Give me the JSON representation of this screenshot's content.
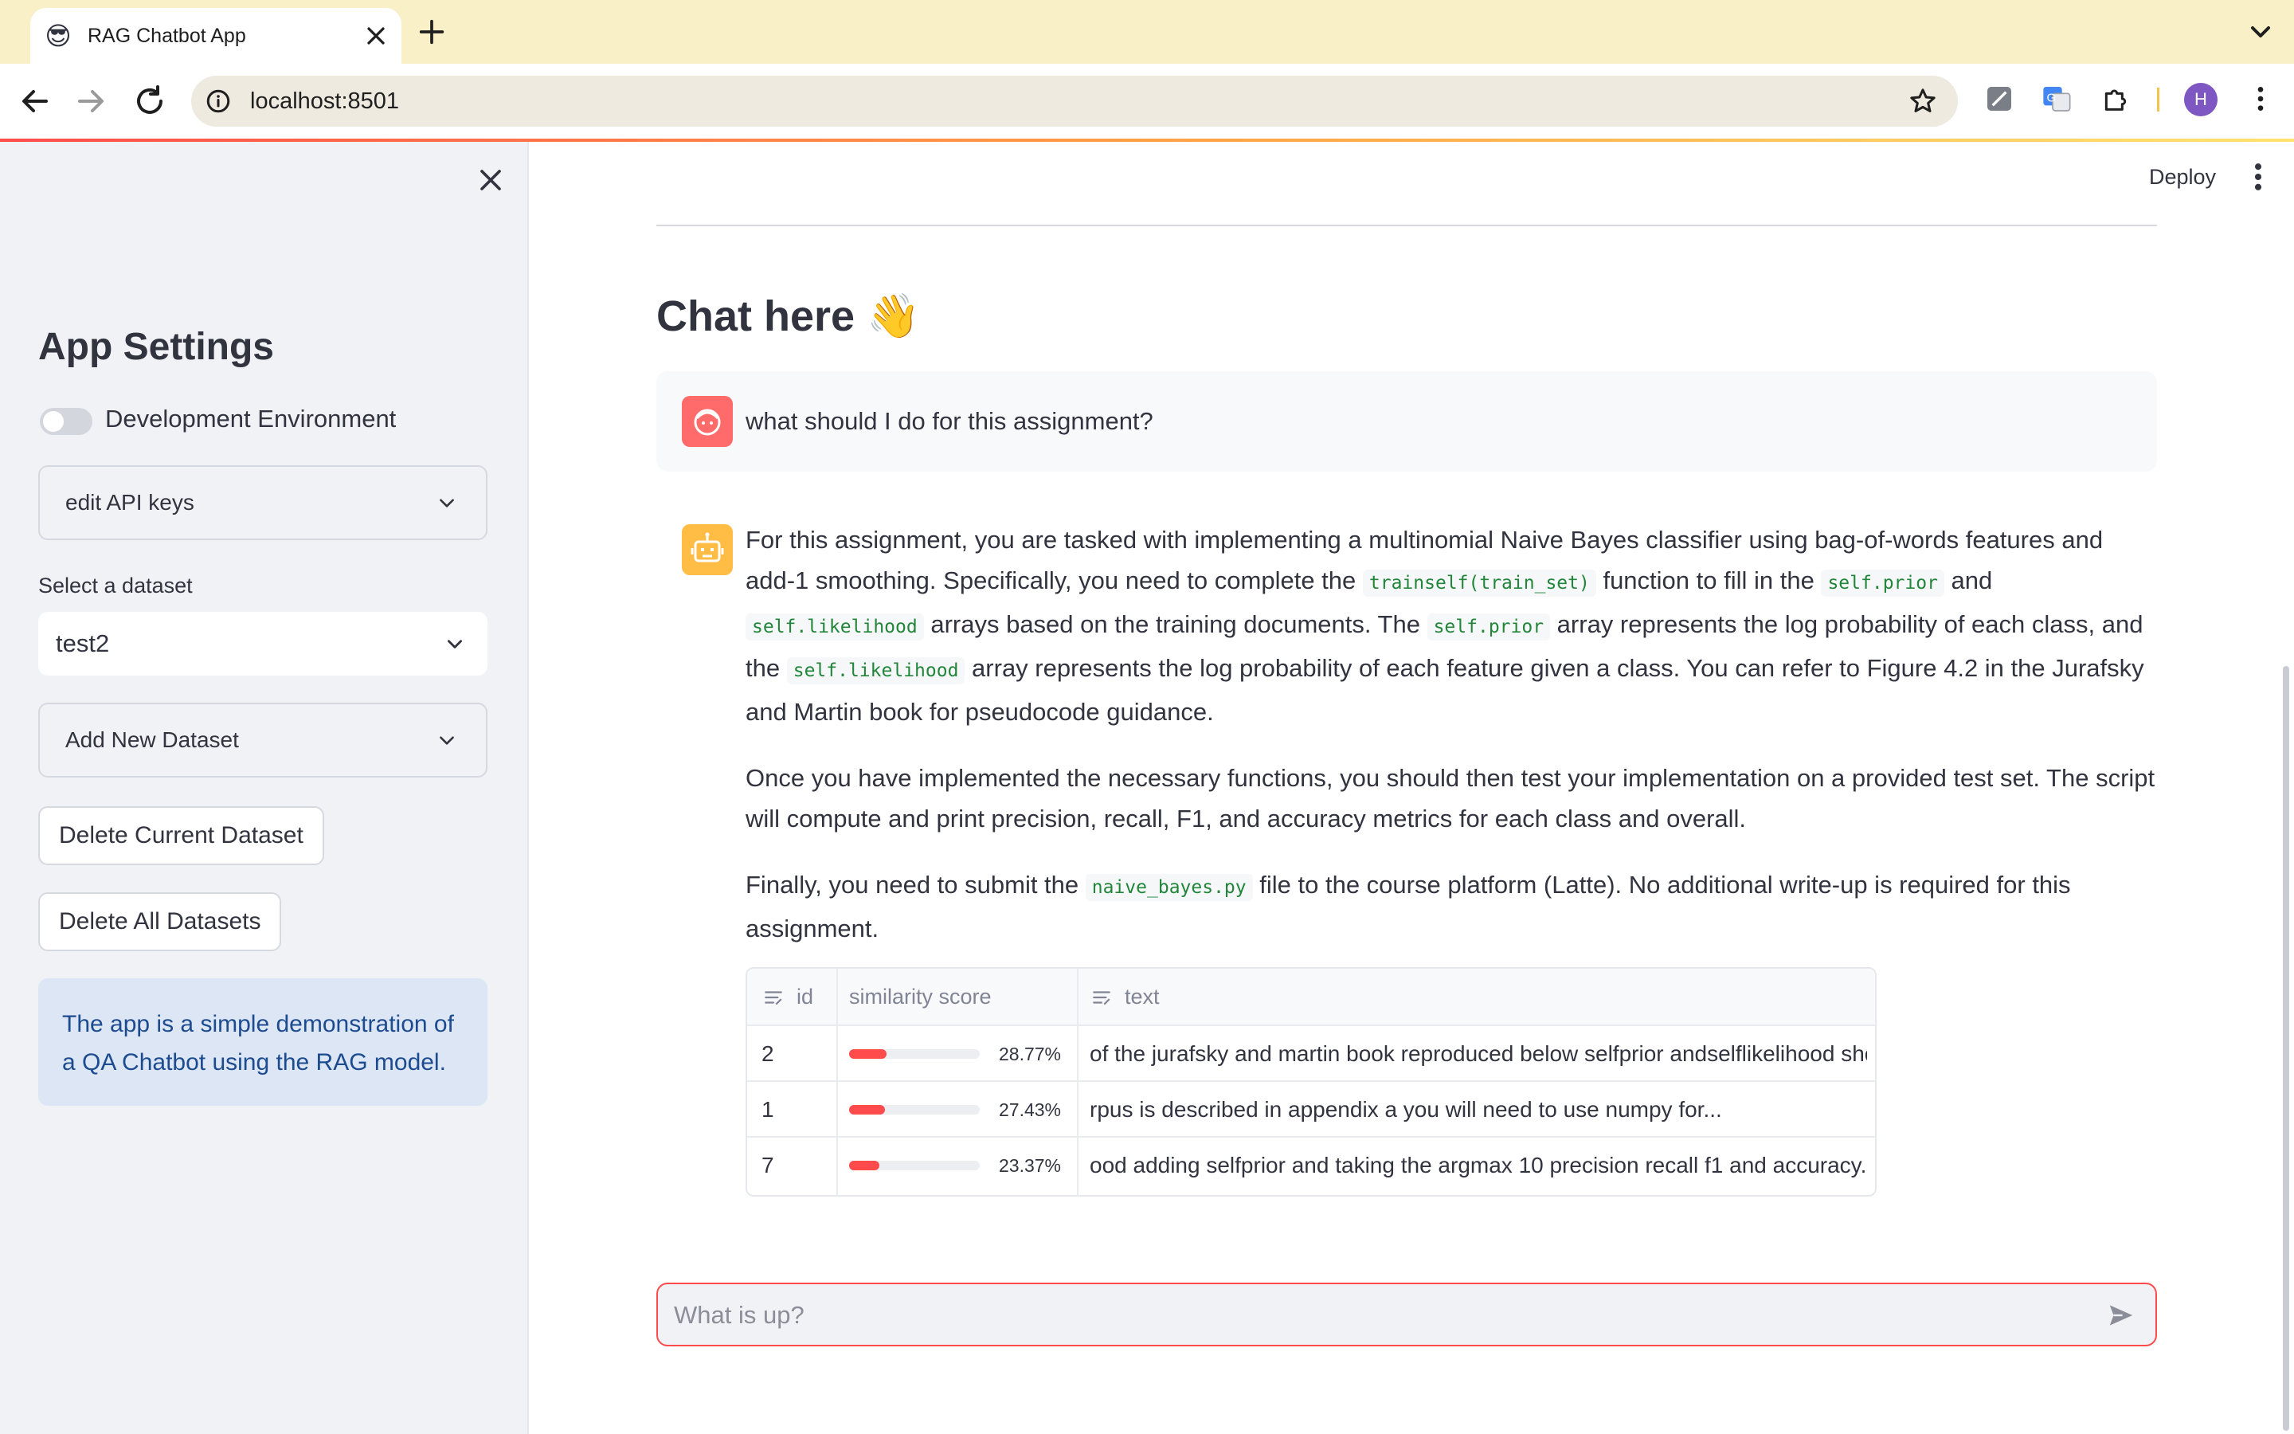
{
  "browser": {
    "tab_title": "RAG Chatbot App",
    "favicon": "😎",
    "url": "localhost:8501",
    "profile_initial": "H"
  },
  "sidebar": {
    "title": "App Settings",
    "toggle_label": "Development Environment",
    "toggle_on": false,
    "api_keys_expander": "edit API keys",
    "dataset_label": "Select a dataset",
    "dataset_selected": "test2",
    "add_dataset_expander": "Add New Dataset",
    "delete_current_label": "Delete Current Dataset",
    "delete_all_label": "Delete All Datasets",
    "info_text": "The app is a simple demonstration of a QA Chatbot using the RAG model."
  },
  "header": {
    "deploy_label": "Deploy"
  },
  "chat": {
    "title": "Chat here 👋",
    "user_message": "what should I do for this assignment?",
    "assistant_paragraphs": {
      "p1": {
        "t1": "For this assignment, you are tasked with implementing a multinomial Naive Bayes classifier using bag-of-words features and add-1 smoothing. Specifically, you need to complete the ",
        "c1": "trainself(train_set)",
        "t2": " function to fill in the ",
        "c2": "self.prior",
        "t3": " and ",
        "c3": "self.likelihood",
        "t4": " arrays based on the training documents. The ",
        "c4": "self.prior",
        "t5": " array represents the log probability of each class, and the ",
        "c5": "self.likelihood",
        "t6": " array represents the log probability of each feature given a class. You can refer to Figure 4.2 in the Jurafsky and Martin book for pseudocode guidance."
      },
      "p2": "Once you have implemented the necessary functions, you should then test your implementation on a provided test set. The script will compute and print precision, recall, F1, and accuracy metrics for each class and overall.",
      "p3": {
        "t1": "Finally, you need to submit the ",
        "c1": "naive_bayes.py",
        "t2": " file to the course platform (Latte). No additional write-up is required for this assignment."
      }
    },
    "table": {
      "columns": [
        "id",
        "similarity score",
        "text"
      ],
      "rows": [
        {
          "id": "2",
          "score": 0.2877,
          "score_label": "28.77%",
          "text": "of the jurafsky and martin book reproduced below selfprior andselflikelihood should"
        },
        {
          "id": "1",
          "score": 0.2743,
          "score_label": "27.43%",
          "text": "rpus is described in appendix a you will need to use numpy for..."
        },
        {
          "id": "7",
          "score": 0.2337,
          "score_label": "23.37%",
          "text": "ood adding selfprior and taking the argmax 10 precision recall f1 and accuracy..."
        }
      ]
    },
    "input_placeholder": "What is up?"
  },
  "colors": {
    "accent": "#ff4b4b",
    "sidebar_bg": "#f0f2f6",
    "info_bg": "#dde6f5",
    "info_text": "#1c4b8f",
    "user_avatar": "#ff6b6b",
    "bot_avatar": "#ffbd45",
    "tab_bar": "#f9f0c8"
  }
}
